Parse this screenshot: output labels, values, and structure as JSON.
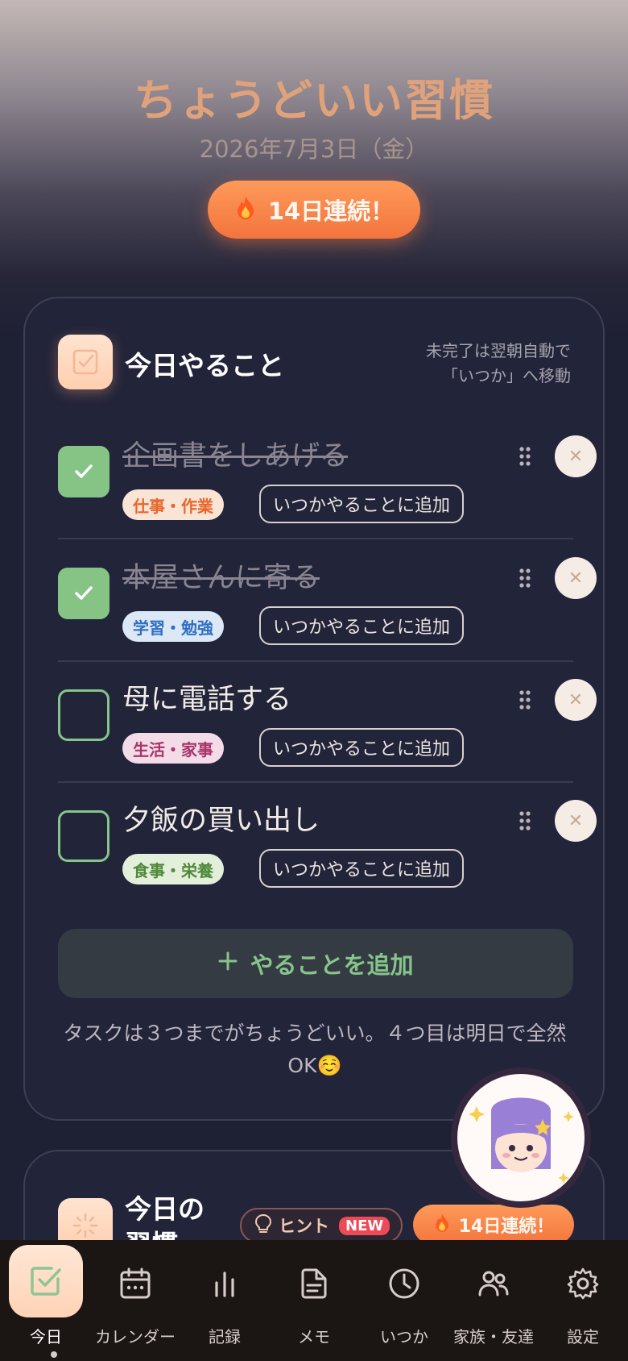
{
  "header": {
    "app_title": "ちょうどいい習慣",
    "date": "2026年7月3日（金）",
    "streak": "14日連続！"
  },
  "today_card": {
    "title": "今日やること",
    "note_line1": "未完了は翌朝自動で",
    "note_line2": "「いつか」へ移動",
    "tasks": [
      {
        "text": "企画書をしあげる",
        "done": true,
        "category": "仕事・作業",
        "category_color": "#e9662a",
        "someday_label": "いつかやることに追加"
      },
      {
        "text": "本屋さんに寄る",
        "done": true,
        "category": "学習・勉強",
        "category_color": "#2f6fc2",
        "someday_label": "いつかやることに追加"
      },
      {
        "text": "母に電話する",
        "done": false,
        "category": "生活・家事",
        "category_color": "#a8346a",
        "someday_label": "いつかやることに追加"
      },
      {
        "text": "夕飯の買い出し",
        "done": false,
        "category": "食事・栄養",
        "category_color": "#4e8a3a",
        "someday_label": "いつかやることに追加"
      }
    ],
    "add_button": "やることを追加",
    "tip": "タスクは３つまでがちょうどいい。４つ目は明日で全然OK☺️"
  },
  "habits_card": {
    "title": "今日の習慣",
    "hint_label": "ヒント",
    "new_badge": "NEW",
    "streak": "14日連続！"
  },
  "tabbar": {
    "tabs": [
      {
        "label": "今日",
        "icon": "check-square-icon",
        "active": true
      },
      {
        "label": "カレンダー",
        "icon": "calendar-icon",
        "active": false
      },
      {
        "label": "記録",
        "icon": "bar-chart-icon",
        "active": false
      },
      {
        "label": "メモ",
        "icon": "document-icon",
        "active": false
      },
      {
        "label": "いつか",
        "icon": "clock-icon",
        "active": false
      },
      {
        "label": "家族・友達",
        "icon": "people-icon",
        "active": false
      },
      {
        "label": "設定",
        "icon": "gear-icon",
        "active": false
      }
    ]
  },
  "colors": {
    "accent_orange": "#f2743c",
    "check_green": "#86c486",
    "background": "#1e2034"
  }
}
